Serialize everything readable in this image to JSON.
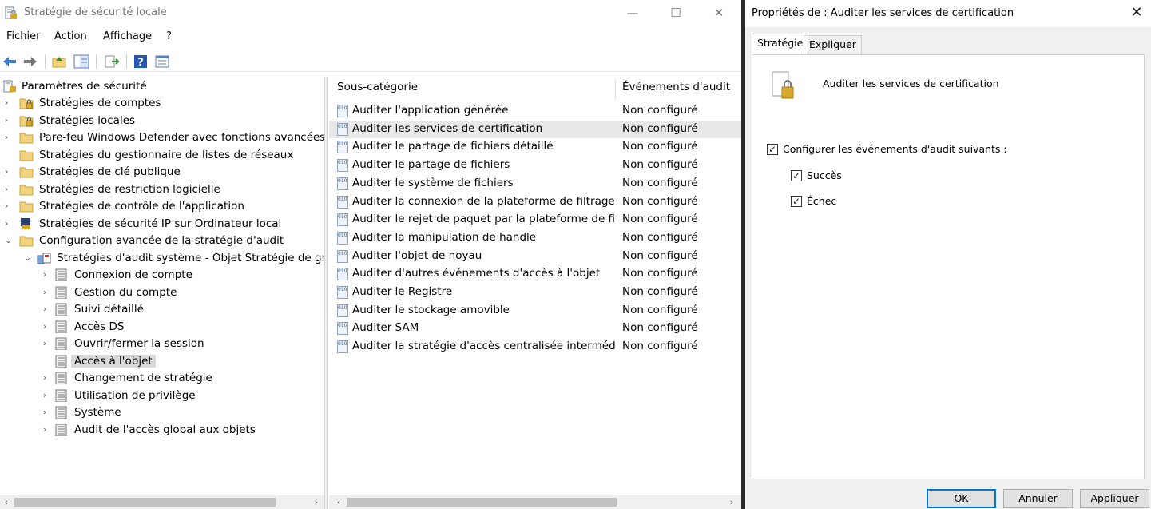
{
  "main_window": {
    "title": "Stratégie de sécurité locale",
    "controls": {
      "minimize": "—",
      "maximize": "☐",
      "close": "✕"
    },
    "menu": [
      "Fichier",
      "Action",
      "Affichage",
      "?"
    ]
  },
  "tree": {
    "root": "Paramètres de sécurité",
    "items": [
      {
        "label": "Stratégies de comptes",
        "arrow": "›"
      },
      {
        "label": "Stratégies locales",
        "arrow": "›"
      },
      {
        "label": "Pare-feu Windows Defender avec fonctions avancées de s",
        "arrow": "›"
      },
      {
        "label": "Stratégies du gestionnaire de listes de réseaux",
        "arrow": ""
      },
      {
        "label": "Stratégies de clé publique",
        "arrow": "›"
      },
      {
        "label": "Stratégies de restriction logicielle",
        "arrow": "›"
      },
      {
        "label": "Stratégies de contrôle de l'application",
        "arrow": "›"
      },
      {
        "label": "Stratégies de sécurité IP sur Ordinateur local",
        "arrow": "›"
      },
      {
        "label": "Configuration avancée de la stratégie d'audit",
        "arrow": "⌄"
      },
      {
        "label": "Stratégies d'audit système - Objet Stratégie de groupe",
        "arrow": "⌄"
      },
      {
        "label": "Connexion de compte",
        "arrow": "›"
      },
      {
        "label": "Gestion du compte",
        "arrow": "›"
      },
      {
        "label": "Suivi détaillé",
        "arrow": "›"
      },
      {
        "label": "Accès DS",
        "arrow": "›"
      },
      {
        "label": "Ouvrir/fermer la session",
        "arrow": "›"
      },
      {
        "label": "Accès à l'objet",
        "arrow": ""
      },
      {
        "label": "Changement de stratégie",
        "arrow": "›"
      },
      {
        "label": "Utilisation de privilège",
        "arrow": "›"
      },
      {
        "label": "Système",
        "arrow": "›"
      },
      {
        "label": "Audit de l'accès global aux objets",
        "arrow": "›"
      }
    ]
  },
  "list": {
    "columns": [
      "Sous-catégorie",
      "Événements d'audit"
    ],
    "rows": [
      {
        "name": "Auditer l'application générée",
        "value": "Non configuré"
      },
      {
        "name": "Auditer les services de certification",
        "value": "Non configuré"
      },
      {
        "name": "Auditer le partage de fichiers détaillé",
        "value": "Non configuré"
      },
      {
        "name": "Auditer le partage de fichiers",
        "value": "Non configuré"
      },
      {
        "name": "Auditer le système de fichiers",
        "value": "Non configuré"
      },
      {
        "name": "Auditer la connexion de la plateforme de filtrage",
        "value": "Non configuré"
      },
      {
        "name": "Auditer le rejet de paquet par la plateforme de filtr...",
        "value": "Non configuré"
      },
      {
        "name": "Auditer la manipulation de handle",
        "value": "Non configuré"
      },
      {
        "name": "Auditer l'objet de noyau",
        "value": "Non configuré"
      },
      {
        "name": "Auditer d'autres événements d'accès à l'objet",
        "value": "Non configuré"
      },
      {
        "name": "Auditer le Registre",
        "value": "Non configuré"
      },
      {
        "name": "Auditer le stockage amovible",
        "value": "Non configuré"
      },
      {
        "name": "Auditer SAM",
        "value": "Non configuré"
      },
      {
        "name": "Auditer la stratégie d'accès centralisée intermédiaire",
        "value": "Non configuré"
      }
    ],
    "row_icon_text": "010 010"
  },
  "scroll": {
    "left": "‹",
    "right": "›"
  },
  "dialog": {
    "title": "Propriétés de : Auditer les services de certification",
    "close": "✕",
    "tabs": [
      "Stratégie",
      "Expliquer"
    ],
    "policy_name": "Auditer les services de certification",
    "configure_label": "Configurer les événements d'audit suivants :",
    "configure_checked": true,
    "success_label": "Succès",
    "success_checked": true,
    "failure_label": "Échec",
    "failure_checked": true,
    "check_mark": "✓",
    "buttons": {
      "ok": "OK",
      "cancel": "Annuler",
      "apply": "Appliquer"
    }
  },
  "colors": {
    "accent": "#0078d7",
    "selected_bg": "#d9d9d9",
    "hover_bg": "#e8e8e8",
    "divider": "#2b2b2b"
  }
}
